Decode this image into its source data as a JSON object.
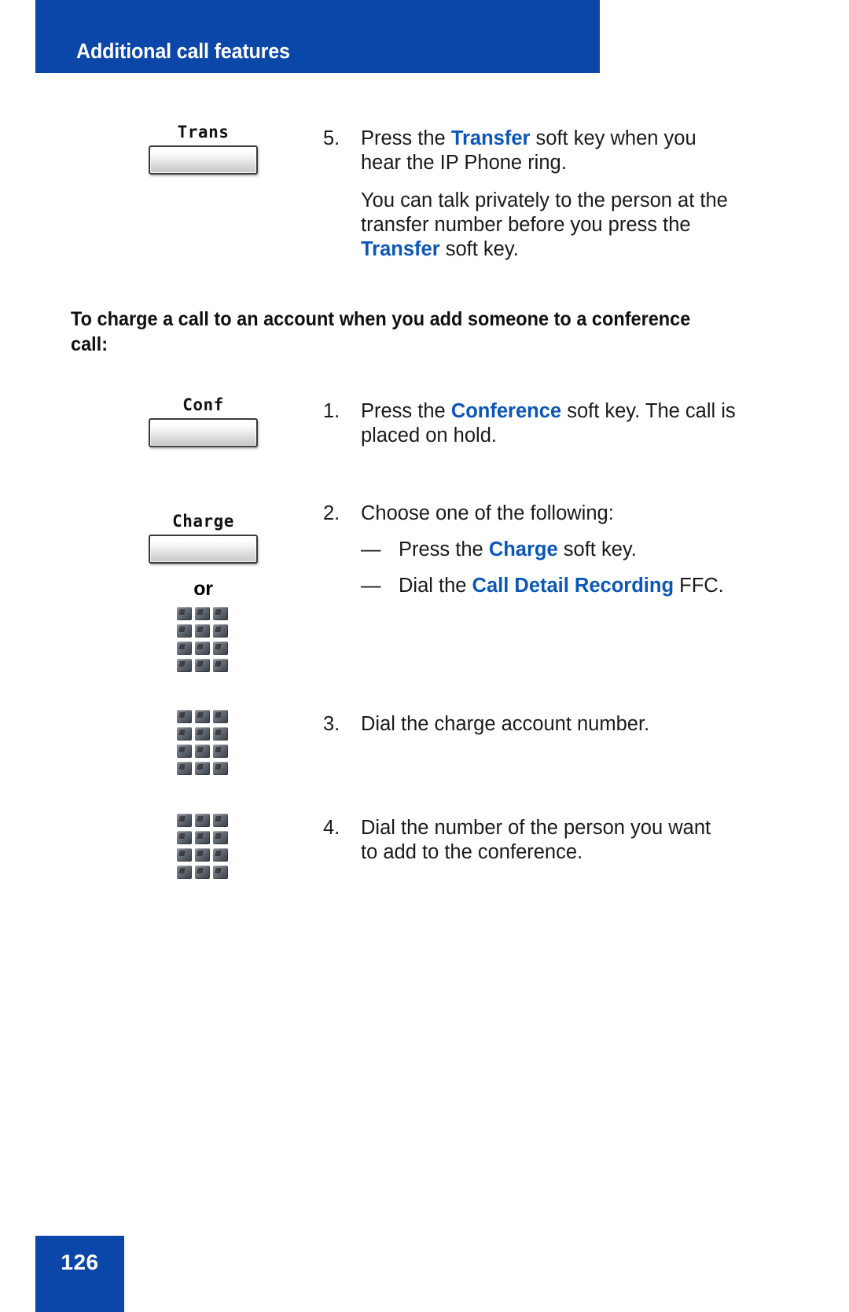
{
  "header": {
    "title": "Additional call features",
    "band_color": "#0b47a8"
  },
  "accent_color": "#0b57b8",
  "blocks": {
    "transfer_step": {
      "number": "5.",
      "softkey_label": "Trans",
      "line_pre": "Press the ",
      "keyword": "Transfer",
      "line_post": " soft key when you hear the IP Phone ring.",
      "note_pre": "You can talk privately to the person at the transfer number before you press the ",
      "note_keyword": "Transfer",
      "note_post": " soft key."
    },
    "section_heading": "To charge a call to an account when you add someone to a conference call:",
    "conference_step": {
      "number": "1.",
      "softkey_label": "Conf",
      "line_pre": "Press the ",
      "keyword": "Conference",
      "line_post": " soft key. The call is placed on hold."
    },
    "choose_step": {
      "number": "2.",
      "softkey_label": "Charge",
      "or_label": "or",
      "prompt": "Choose one of the following:",
      "options": [
        {
          "dash": "—",
          "pre": "Press the ",
          "keyword": "Charge",
          "post": " soft key."
        },
        {
          "dash": "—",
          "pre": "Dial the ",
          "keyword": "Call Detail Recording",
          "post": " FFC."
        }
      ]
    },
    "dial_account_step": {
      "number": "3.",
      "text": "Dial the charge account number."
    },
    "dial_person_step": {
      "number": "4.",
      "text": "Dial the number of the person you want to add to the conference."
    }
  },
  "footer": {
    "page_number": "126",
    "band_color": "#0b47a8"
  }
}
